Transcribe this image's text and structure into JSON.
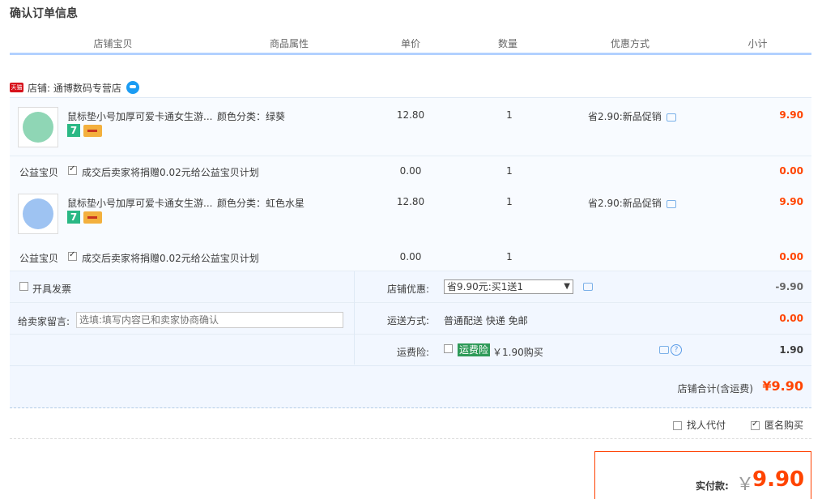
{
  "page_title": "确认订单信息",
  "columns": [
    "店铺宝贝",
    "商品属性",
    "单价",
    "数量",
    "优惠方式",
    "小计"
  ],
  "shop": {
    "badge": "天猫",
    "label": "店铺: 通博数码专营店"
  },
  "items": [
    {
      "title": "鼠标垫小号加厚可爱卡通女生游...",
      "attr": "颜色分类：绿葵",
      "price": "12.80",
      "qty": "1",
      "promo": "省2.90:新品促销",
      "subtotal": "9.90",
      "badge7": "7",
      "thumb_color": "#8fd6b5"
    },
    {
      "title": "鼠标垫小号加厚可爱卡通女生游...",
      "attr": "颜色分类：虹色水星",
      "price": "12.80",
      "qty": "1",
      "promo": "省2.90:新品促销",
      "subtotal": "9.90",
      "badge7": "7",
      "thumb_color": "#9ec3f2"
    }
  ],
  "charity": {
    "label": "公益宝贝",
    "text": "成交后卖家将捐赠0.02元给公益宝贝计划",
    "price": "0.00",
    "qty": "1",
    "subtotal": "0.00"
  },
  "invoice_label": "开具发票",
  "message": {
    "label": "给卖家留言:",
    "placeholder": "选填:填写内容已和卖家协商确认"
  },
  "shop_coupon": {
    "label": "店铺优惠:",
    "selected": "省9.90元:买1送1",
    "value": "-9.90"
  },
  "shipping": {
    "label": "运送方式:",
    "text": "普通配送 快递 免邮",
    "value": "0.00"
  },
  "insurance": {
    "label": "运费险:",
    "tag": "运费险",
    "price_text": "￥1.90购买",
    "value": "1.90",
    "help": "?"
  },
  "shop_total": {
    "label": "店铺合计(含运费)",
    "value": "¥9.90"
  },
  "options": {
    "proxy": "找人代付",
    "anonymous": "匿名购买"
  },
  "payment": {
    "label": "实付款:",
    "yen": "￥",
    "amount": "9.90"
  },
  "colors": {
    "accent_red": "#ff4400",
    "header_line": "#b2d1ff",
    "row_bg": "#f2f7ff"
  }
}
